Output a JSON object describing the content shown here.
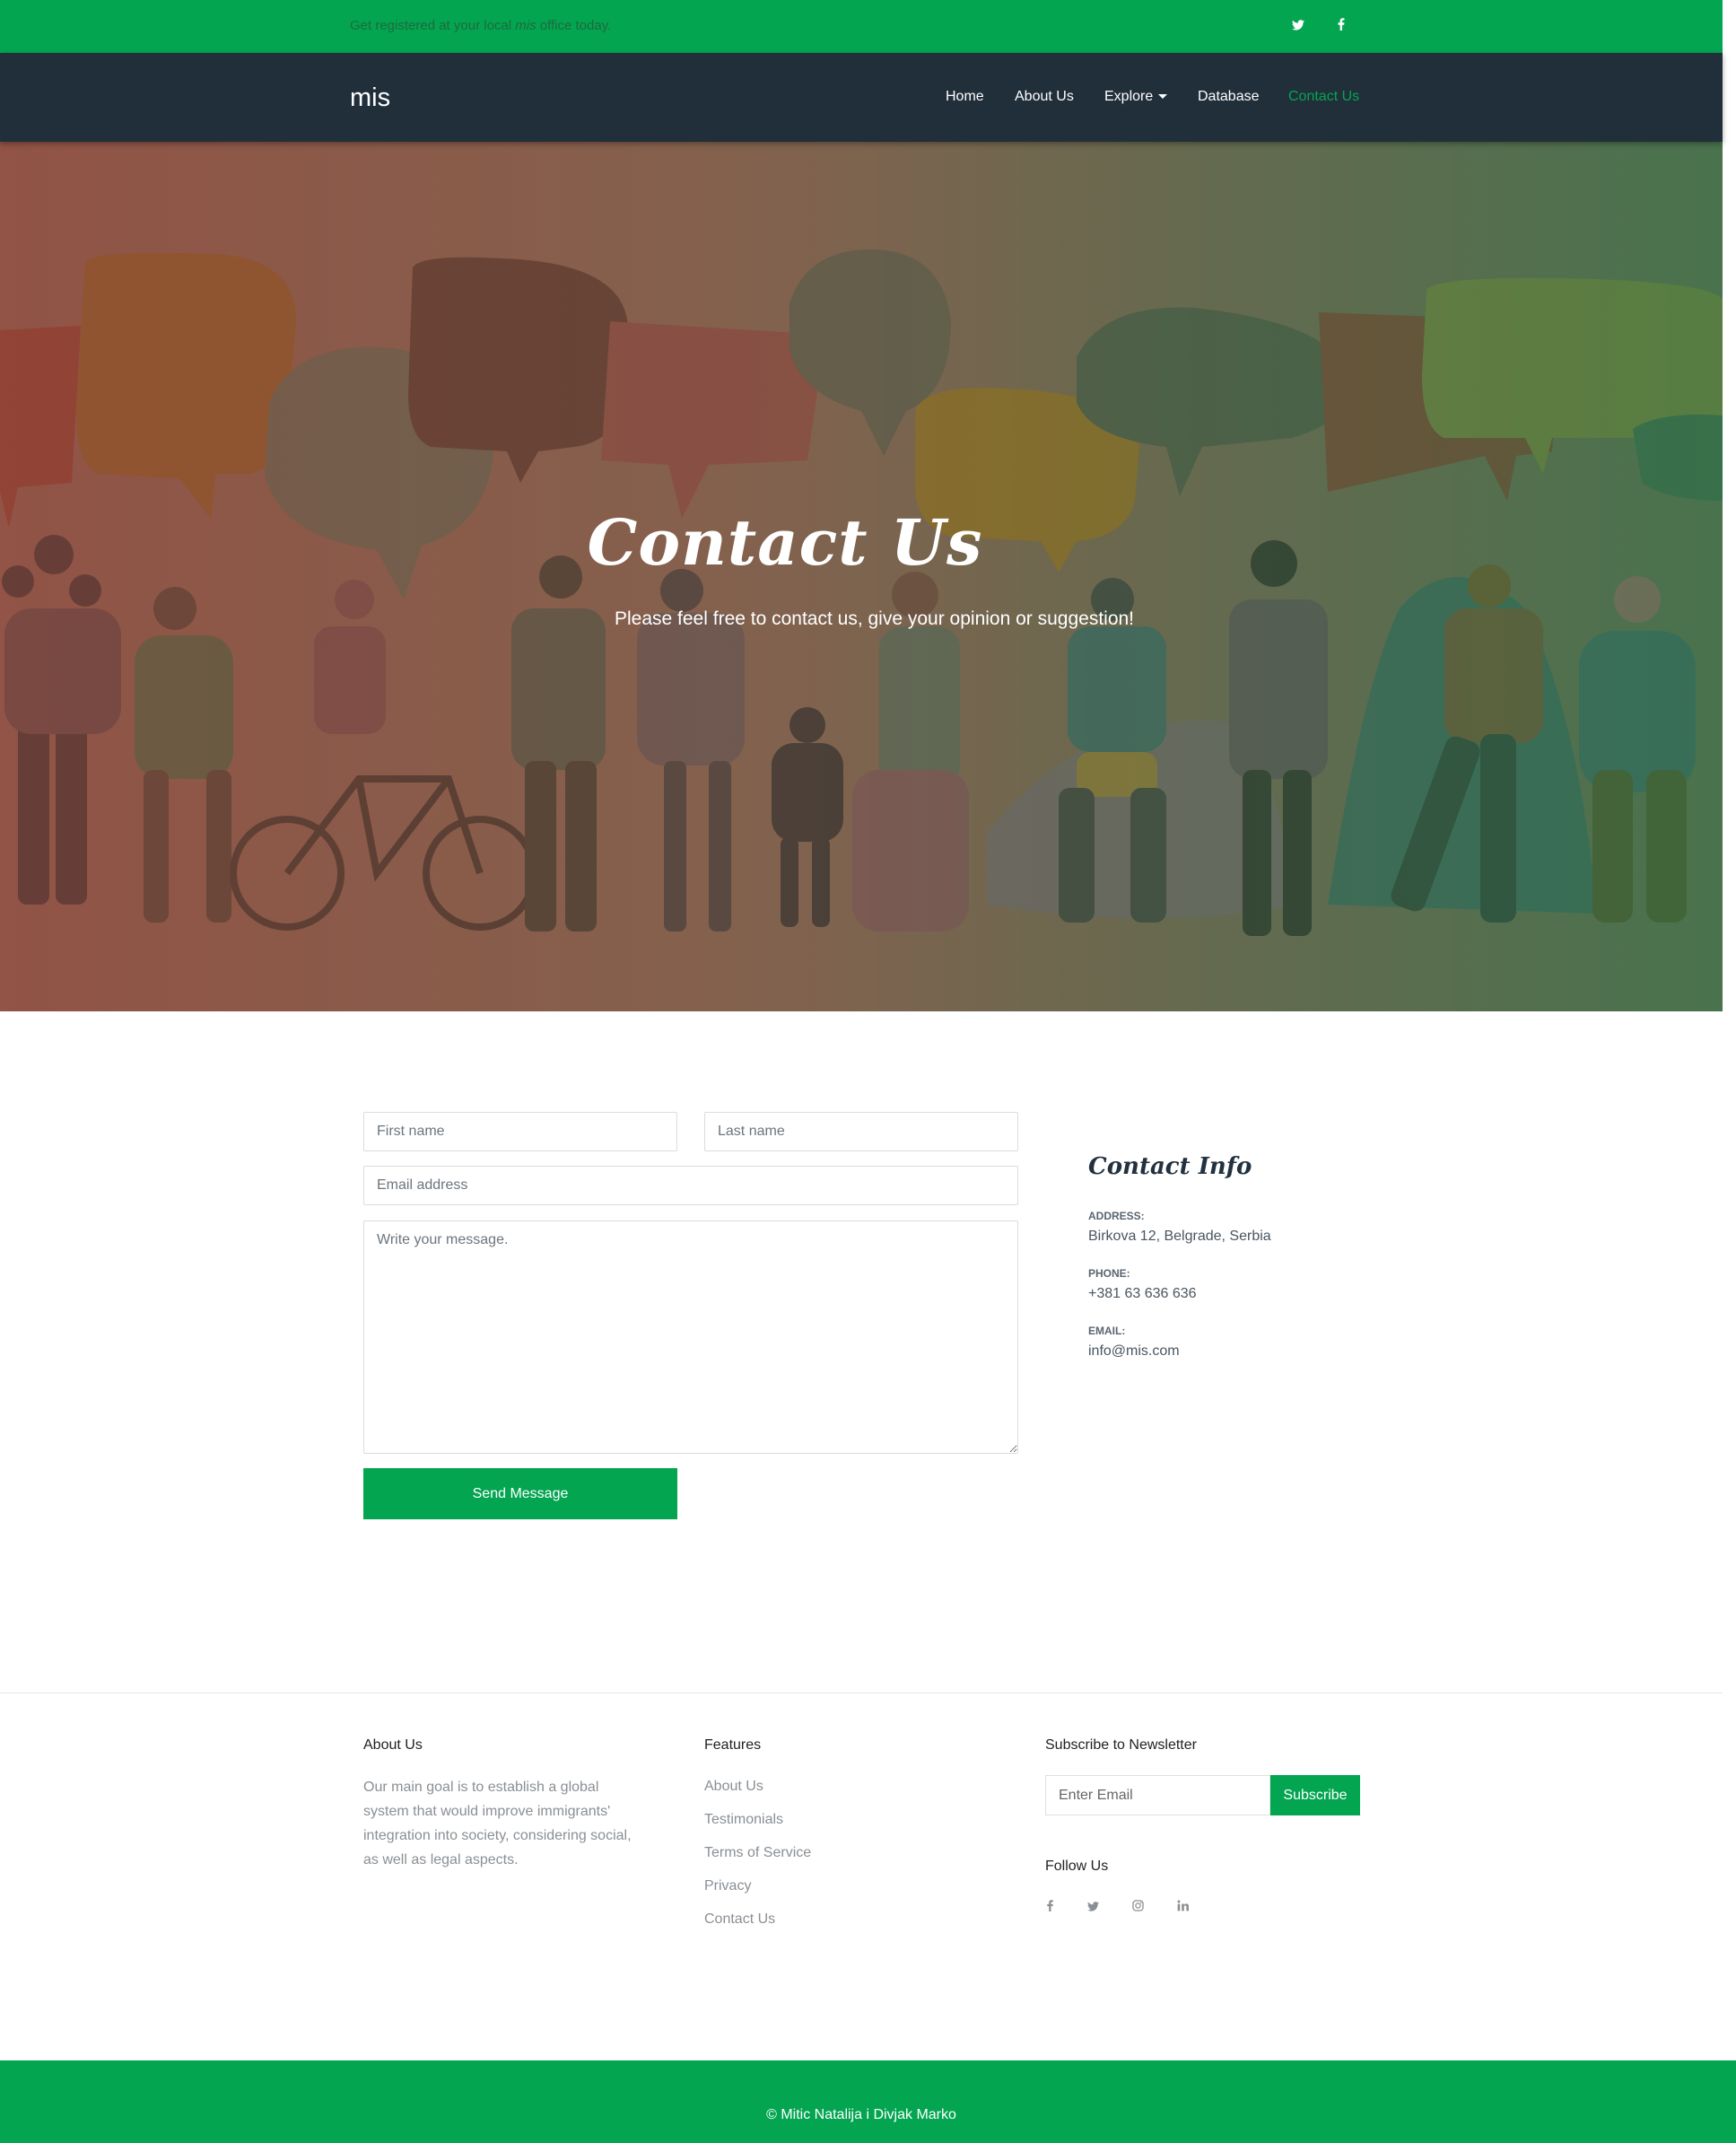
{
  "topbar": {
    "tagline_before": "Get registered at your local ",
    "tagline_emph": "mis",
    "tagline_after": " office today.",
    "social": [
      {
        "icon": "twitter-icon",
        "glyph": "✉"
      },
      {
        "icon": "facebook-icon",
        "glyph": "f"
      }
    ]
  },
  "navbar": {
    "brand": "mis",
    "items": [
      {
        "label": "Home",
        "active": false
      },
      {
        "label": "About Us",
        "active": false
      },
      {
        "label": "Explore",
        "active": false,
        "dropdown": true
      },
      {
        "label": "Database",
        "active": false
      },
      {
        "label": "Contact Us",
        "active": true
      }
    ]
  },
  "hero": {
    "title": "Contact Us",
    "subtitle": "Please feel free to contact us, give your opinion or suggestion!"
  },
  "form": {
    "first_name_placeholder": "First name",
    "last_name_placeholder": "Last name",
    "email_placeholder": "Email address",
    "message_placeholder": "Write your message.",
    "submit_label": "Send Message"
  },
  "contact_info": {
    "title": "Contact Info",
    "address_label": "Address:",
    "address": "Birkova 12, Belgrade, Serbia",
    "phone_label": "Phone:",
    "phone": "+381 63 636 636",
    "email_label": "Email:",
    "email": "info@mis.com"
  },
  "footer": {
    "about": {
      "title": "About Us",
      "text": "Our main goal is to establish a global system that would improve immigrants' integration into society, considering social, as well as legal aspects."
    },
    "features": {
      "title": "Features",
      "links": [
        "About Us",
        "Testimonials",
        "Terms of Service",
        "Privacy",
        "Contact Us"
      ]
    },
    "newsletter": {
      "title": "Subscribe to Newsletter",
      "placeholder": "Enter Email",
      "button": "Subscribe"
    },
    "follow": {
      "title": "Follow Us",
      "icons": [
        "facebook-icon",
        "twitter-icon",
        "instagram-icon",
        "linkedin-icon"
      ]
    },
    "copyright": "© Mitic Natalija i Divjak Marko"
  },
  "colors": {
    "brand_green": "#04a551",
    "navbar_dark": "#212f3b"
  }
}
